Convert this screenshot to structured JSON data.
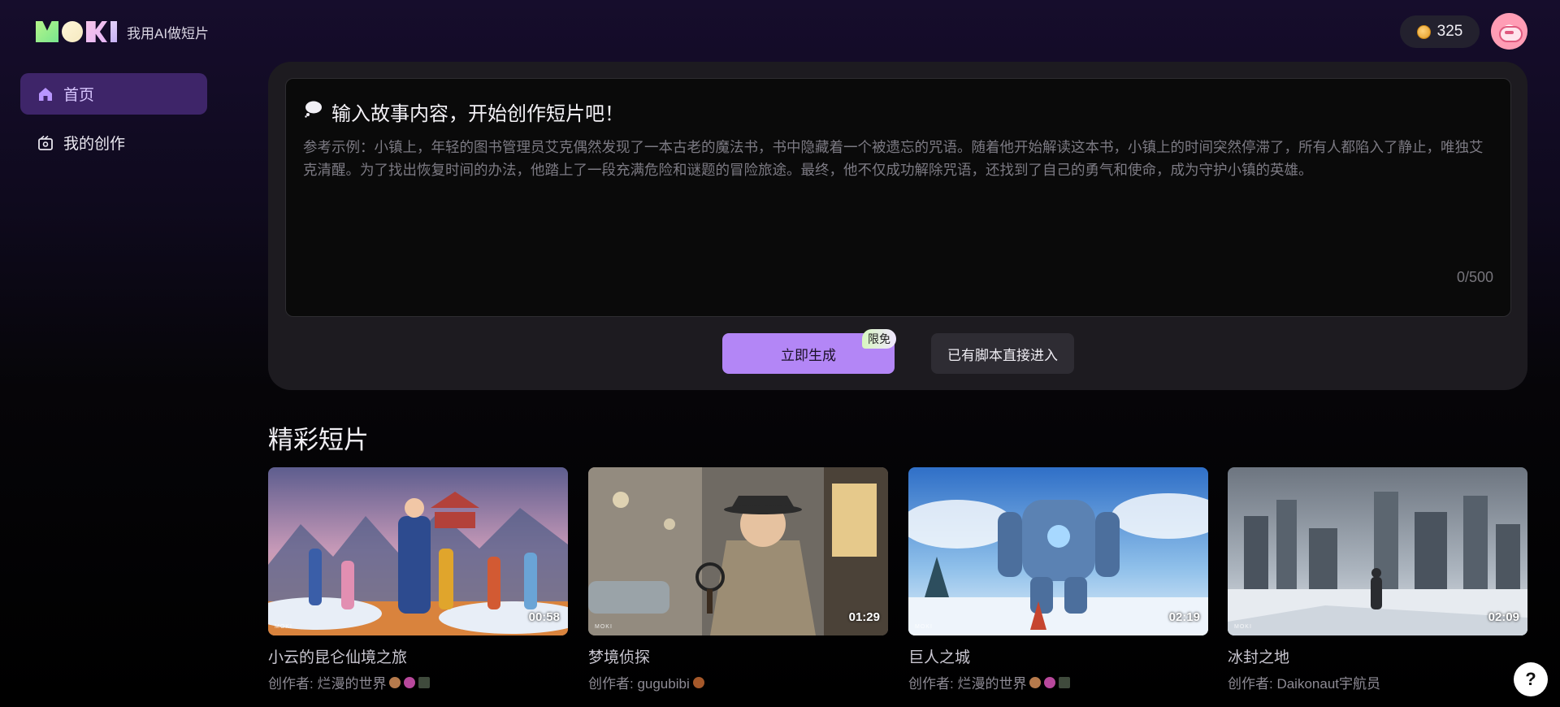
{
  "header": {
    "brand_tagline": "我用AI做短片",
    "coins": "325",
    "logo_text": "MOKI"
  },
  "sidebar": {
    "items": [
      {
        "label": "首页",
        "icon": "home-icon",
        "active": true
      },
      {
        "label": "我的创作",
        "icon": "creation-icon",
        "active": false
      }
    ]
  },
  "composer": {
    "title": "输入故事内容，开始创作短片吧！",
    "placeholder": "参考示例：小镇上，年轻的图书管理员艾克偶然发现了一本古老的魔法书，书中隐藏着一个被遗忘的咒语。随着他开始解读这本书，小镇上的时间突然停滞了，所有人都陷入了静止，唯独艾克清醒。为了找出恢复时间的办法，他踏上了一段充满危险和谜题的冒险旅途。最终，他不仅成功解除咒语，还找到了自己的勇气和使命，成为守护小镇的英雄。",
    "counter": "0/500",
    "generate_label": "立即生成",
    "free_badge": "限免",
    "script_label": "已有脚本直接进入"
  },
  "featured": {
    "title": "精彩短片",
    "cards": [
      {
        "title": "小云的昆仑仙境之旅",
        "author": "创作者: 烂漫的世界",
        "duration": "00:58"
      },
      {
        "title": "梦境侦探",
        "author": "创作者: gugubibi",
        "duration": "01:29"
      },
      {
        "title": "巨人之城",
        "author": "创作者: 烂漫的世界",
        "duration": "02:19"
      },
      {
        "title": "冰封之地",
        "author": "创作者: Daikonaut宇航员",
        "duration": "02:09"
      }
    ]
  },
  "help": {
    "label": "?"
  },
  "colors": {
    "accent": "#b386f6",
    "sidebar_active": "#3e2569",
    "panel": "#1d1b20"
  }
}
